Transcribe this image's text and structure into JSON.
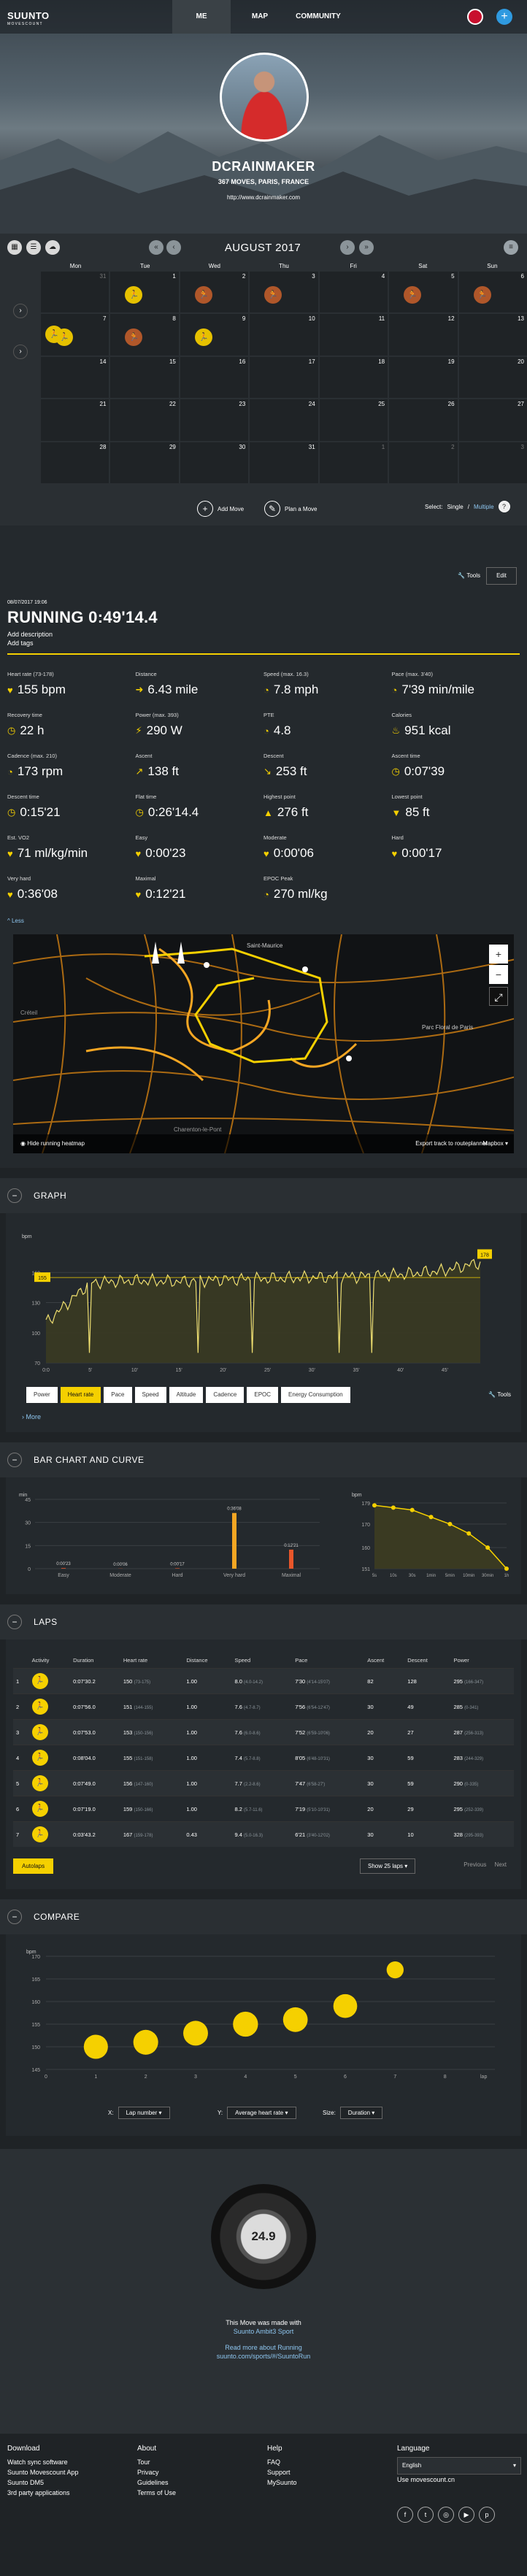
{
  "header": {
    "brand": "SUUNTO",
    "brand_sub": "MOVESCOUNT",
    "nav": [
      "ME",
      "MAP",
      "COMMUNITY"
    ],
    "username": "DCRAINMAKER",
    "info": "367 MOVES, PARIS, FRANCE",
    "link": "http://www.dcrainmaker.com"
  },
  "calendar": {
    "month": "AUGUST 2017",
    "days": [
      "Mon",
      "Tue",
      "Wed",
      "Thu",
      "Fri",
      "Sat",
      "Sun"
    ],
    "weeks": [
      [
        "31",
        "1",
        "2",
        "3",
        "4",
        "5",
        "6"
      ],
      [
        "7",
        "8",
        "9",
        "10",
        "11",
        "12",
        "13"
      ],
      [
        "14",
        "15",
        "16",
        "17",
        "18",
        "19",
        "20"
      ],
      [
        "21",
        "22",
        "23",
        "24",
        "25",
        "26",
        "27"
      ],
      [
        "28",
        "29",
        "30",
        "31",
        "1",
        "2",
        "3"
      ]
    ],
    "add_move": "Add Move",
    "plan_move": "Plan a Move",
    "select_label": "Select:",
    "select_single": "Single",
    "select_sep": "/",
    "select_multiple": "Multiple"
  },
  "move": {
    "tools": "Tools",
    "edit": "Edit",
    "date": "08/07/2017 19:06",
    "title": "RUNNING  0:49'14.4",
    "add_description": "Add description",
    "add_tags": "Add tags",
    "stats": [
      {
        "label": "Heart rate  (73-178)",
        "value": "155 bpm",
        "icon": "♥"
      },
      {
        "label": "Distance",
        "value": "6.43 mile",
        "icon": "➜"
      },
      {
        "label": "Speed  (max. 16.3)",
        "value": "7.8 mph",
        "icon": "◔"
      },
      {
        "label": "Pace  (max. 3'40)",
        "value": "7'39 min/mile",
        "icon": "◔"
      },
      {
        "label": "Recovery time",
        "value": "22 h",
        "icon": "◷"
      },
      {
        "label": "Power  (max. 393)",
        "value": "290 W",
        "icon": "⚡"
      },
      {
        "label": "PTE",
        "value": "4.8",
        "icon": "◔"
      },
      {
        "label": "Calories",
        "value": "951 kcal",
        "icon": "♨"
      },
      {
        "label": "Cadence  (max. 210)",
        "value": "173 rpm",
        "icon": "◔"
      },
      {
        "label": "Ascent",
        "value": "138 ft",
        "icon": "↗"
      },
      {
        "label": "Descent",
        "value": "253 ft",
        "icon": "↘"
      },
      {
        "label": "Ascent time",
        "value": "0:07'39",
        "icon": "◷"
      },
      {
        "label": "Descent time",
        "value": "0:15'21",
        "icon": "◷"
      },
      {
        "label": "Flat time",
        "value": "0:26'14.4",
        "icon": "◷"
      },
      {
        "label": "Highest point",
        "value": "276 ft",
        "icon": "▲"
      },
      {
        "label": "Lowest point",
        "value": "85 ft",
        "icon": "▼"
      },
      {
        "label": "Est. VO2",
        "value": "71 ml/kg/min",
        "icon": "♥"
      },
      {
        "label": "Easy",
        "value": "0:00'23",
        "icon": "♥"
      },
      {
        "label": "Moderate",
        "value": "0:00'06",
        "icon": "♥"
      },
      {
        "label": "Hard",
        "value": "0:00'17",
        "icon": "♥"
      },
      {
        "label": "Very hard",
        "value": "0:36'08",
        "icon": "♥"
      },
      {
        "label": "Maximal",
        "value": "0:12'21",
        "icon": "♥"
      },
      {
        "label": "EPOC Peak",
        "value": "270 ml/kg",
        "icon": "◔"
      }
    ],
    "less": "^ Less"
  },
  "map": {
    "hide_heatmap": "Hide running heatmap",
    "export": "Export track to routeplanner",
    "provider": "Mapbox",
    "labels": [
      "Saint-Maurice",
      "Parc Floral de Paris",
      "Charenton-le-Pont",
      "Créteil"
    ]
  },
  "graph": {
    "title": "GRAPH",
    "tabs": [
      "Power",
      "Heart rate",
      "Pace",
      "Speed",
      "Altitude",
      "Cadence",
      "EPOC",
      "Energy Consumption"
    ],
    "tools": "Tools",
    "more": "More"
  },
  "bars": {
    "title": "BAR CHART AND CURVE"
  },
  "laps": {
    "title": "LAPS",
    "headers": [
      "",
      "Activity",
      "Duration",
      "Heart rate",
      "Distance",
      "Speed",
      "Pace",
      "Ascent",
      "Descent",
      "Power"
    ],
    "rows": [
      {
        "n": "1",
        "dur": "0:07'30.2",
        "hr": "150",
        "hr2": "(73-175)",
        "dist": "1.00",
        "spd": "8.0",
        "spd2": "(4.0-14.2)",
        "pace": "7'30",
        "pace2": "(4'14-15'07)",
        "asc": "82",
        "desc": "128",
        "pw": "295",
        "pw2": "(166-347)"
      },
      {
        "n": "2",
        "dur": "0:07'56.0",
        "hr": "151",
        "hr2": "(144-155)",
        "dist": "1.00",
        "spd": "7.6",
        "spd2": "(4.7-8.7)",
        "pace": "7'56",
        "pace2": "(6'54-12'47)",
        "asc": "30",
        "desc": "49",
        "pw": "285",
        "pw2": "(0-341)"
      },
      {
        "n": "3",
        "dur": "0:07'53.0",
        "hr": "153",
        "hr2": "(150-156)",
        "dist": "1.00",
        "spd": "7.6",
        "spd2": "(6.0-8.6)",
        "pace": "7'52",
        "pace2": "(6'59-10'06)",
        "asc": "20",
        "desc": "27",
        "pw": "287",
        "pw2": "(256-313)"
      },
      {
        "n": "4",
        "dur": "0:08'04.0",
        "hr": "155",
        "hr2": "(151-158)",
        "dist": "1.00",
        "spd": "7.4",
        "spd2": "(5.7-8.8)",
        "pace": "8'05",
        "pace2": "(6'48-10'31)",
        "asc": "30",
        "desc": "59",
        "pw": "283",
        "pw2": "(244-329)"
      },
      {
        "n": "5",
        "dur": "0:07'49.0",
        "hr": "156",
        "hr2": "(147-160)",
        "dist": "1.00",
        "spd": "7.7",
        "spd2": "(2.2-8.6)",
        "pace": "7'47",
        "pace2": "(6'58-27')",
        "asc": "30",
        "desc": "59",
        "pw": "290",
        "pw2": "(0-335)"
      },
      {
        "n": "6",
        "dur": "0:07'19.0",
        "hr": "159",
        "hr2": "(150-166)",
        "dist": "1.00",
        "spd": "8.2",
        "spd2": "(5.7-11.6)",
        "pace": "7'19",
        "pace2": "(5'10-10'31)",
        "asc": "20",
        "desc": "29",
        "pw": "295",
        "pw2": "(252-339)"
      },
      {
        "n": "7",
        "dur": "0:03'43.2",
        "hr": "167",
        "hr2": "(159-178)",
        "dist": "0.43",
        "spd": "9.4",
        "spd2": "(5.0-16.3)",
        "pace": "6'21",
        "pace2": "(3'40-12'02)",
        "asc": "30",
        "desc": "10",
        "pw": "328",
        "pw2": "(295-393)"
      }
    ],
    "autolaps": "Autolaps",
    "show": "Show 25 laps",
    "prev": "Previous",
    "next": "Next"
  },
  "compare": {
    "title": "COMPARE",
    "x_label": "X:",
    "x_value": "Lap number",
    "y_label": "Y:",
    "y_value": "Average heart rate",
    "size_label": "Size:",
    "size_value": "Duration"
  },
  "promo": {
    "watch_time": "24.9",
    "made_with": "This Move was made with",
    "device": "Suunto Ambit3 Sport",
    "read_more": "Read more about Running",
    "url": "suunto.com/sports/#/SuuntoRun"
  },
  "footer": {
    "download_title": "Download",
    "download": [
      "Watch sync software",
      "Suunto Movescount App",
      "Suunto DM5",
      "3rd party applications"
    ],
    "about_title": "About",
    "about": [
      "Tour",
      "Privacy",
      "Guidelines",
      "Terms of Use"
    ],
    "help_title": "Help",
    "help": [
      "FAQ",
      "Support",
      "MySuunto"
    ],
    "language_title": "Language",
    "language": "English",
    "alt_site": "Use movescount.cn"
  },
  "chart_data": [
    {
      "type": "line",
      "title": "",
      "ylabel": "bpm",
      "xlabel": "",
      "x": [
        0,
        5,
        10,
        15,
        20,
        25,
        30,
        35,
        40,
        45,
        49
      ],
      "series": [
        {
          "name": "Heart rate",
          "values": [
            110,
            150,
            152,
            151,
            153,
            154,
            155,
            156,
            158,
            162,
            170
          ]
        }
      ],
      "ylim": [
        70,
        190
      ],
      "yticks": [
        70,
        100,
        130,
        160
      ],
      "xticks": [
        "0:0",
        "5'",
        "10'",
        "15'",
        "20'",
        "25'",
        "30'",
        "35'",
        "40'",
        "45'"
      ],
      "markers": [
        "155",
        "178"
      ]
    },
    {
      "type": "bar",
      "ylabel": "min",
      "categories": [
        "Easy",
        "Moderate",
        "Hard",
        "Very hard",
        "Maximal"
      ],
      "values": [
        0.38,
        0.1,
        0.28,
        36.13,
        12.35
      ],
      "labels": [
        "0:00'23",
        "0:00'06",
        "0:00'17",
        "0:36'08",
        "0:12'21"
      ],
      "ylim": [
        0,
        45
      ],
      "yticks": [
        0,
        15,
        30,
        45
      ]
    },
    {
      "type": "area",
      "ylabel": "bpm",
      "categories": [
        "5s",
        "10s",
        "30s",
        "1min",
        "5min",
        "10min",
        "30min",
        "1h"
      ],
      "values": [
        178,
        177,
        176,
        173,
        170,
        166,
        160,
        151
      ],
      "ylim": [
        151,
        179
      ],
      "yticks": [
        151,
        160,
        170,
        179
      ]
    },
    {
      "type": "scatter",
      "ylabel": "bpm",
      "xlabel": "lap",
      "x": [
        1,
        2,
        3,
        4,
        5,
        6,
        7
      ],
      "y": [
        150,
        151,
        153,
        155,
        156,
        159,
        167
      ],
      "sizes": [
        450,
        476,
        473,
        484,
        469,
        439,
        223
      ],
      "xlim": [
        0,
        9
      ],
      "ylim": [
        145,
        170
      ],
      "yticks": [
        145,
        150,
        155,
        160,
        165,
        170
      ]
    }
  ]
}
